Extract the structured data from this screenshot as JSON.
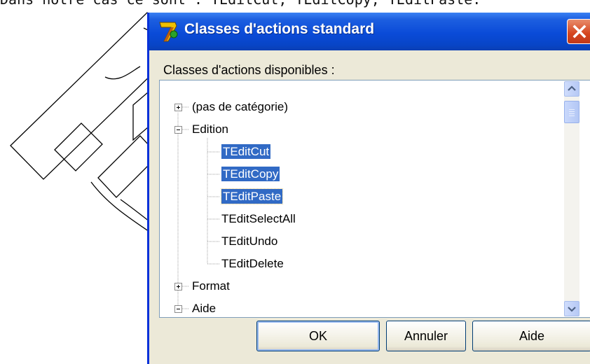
{
  "document": {
    "line_text": "Dans notre cas ce sont : TEditCut, TEditCopy, TEditPaste."
  },
  "dialog": {
    "title": "Classes d'actions standard",
    "group_label": "Classes d'actions disponibles :",
    "tree": [
      {
        "label": "(pas de catégorie)",
        "level": 0,
        "expander": "plus",
        "selected": false
      },
      {
        "label": "Edition",
        "level": 0,
        "expander": "minus",
        "selected": false
      },
      {
        "label": "TEditCut",
        "level": 1,
        "selected": true
      },
      {
        "label": "TEditCopy",
        "level": 1,
        "selected": true
      },
      {
        "label": "TEditPaste",
        "level": 1,
        "selected": true,
        "focused": true
      },
      {
        "label": "TEditSelectAll",
        "level": 1,
        "selected": false
      },
      {
        "label": "TEditUndo",
        "level": 1,
        "selected": false
      },
      {
        "label": "TEditDelete",
        "level": 1,
        "selected": false
      },
      {
        "label": "Format",
        "level": 0,
        "expander": "plus",
        "selected": false
      },
      {
        "label": "Aide",
        "level": 0,
        "expander": "minus",
        "selected": false
      }
    ],
    "buttons": {
      "ok": "OK",
      "cancel": "Annuler",
      "help": "Aide"
    }
  },
  "colors": {
    "titlebar": "#0a4bd8",
    "selection": "#316ac5",
    "dialog_face": "#ece9d8",
    "close_button": "#d5441d"
  },
  "icons": {
    "app": "delphi-7-icon",
    "close": "close-x-icon",
    "expand": "plus-box-icon",
    "collapse": "minus-box-icon",
    "scroll_up": "arrow-up-icon",
    "scroll_down": "arrow-down-icon"
  }
}
